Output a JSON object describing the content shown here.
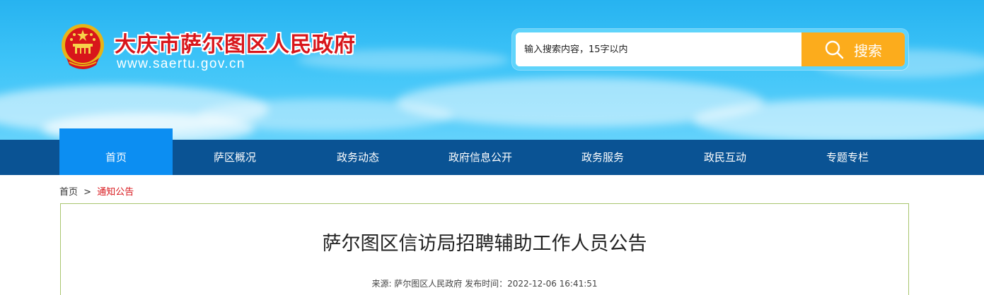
{
  "header": {
    "site_title": "大庆市萨尔图区人民政府",
    "site_url": "www.saertu.gov.cn",
    "emblem_icon": "national-emblem-icon"
  },
  "search": {
    "placeholder": "输入搜索内容，15字以内",
    "button_label": "搜索",
    "button_color": "#fcac1c"
  },
  "nav": {
    "items": [
      {
        "label": "首页",
        "active": true
      },
      {
        "label": "萨区概况"
      },
      {
        "label": "政务动态"
      },
      {
        "label": "政府信息公开"
      },
      {
        "label": "政务服务"
      },
      {
        "label": "政民互动"
      },
      {
        "label": "专题专栏"
      }
    ],
    "bar_color": "#0a5394",
    "active_color": "#0c8ef2"
  },
  "breadcrumb": {
    "home": "首页",
    "separator": ">",
    "current": "通知公告"
  },
  "article": {
    "title": "萨尔图区信访局招聘辅助工作人员公告",
    "meta": "来源: 萨尔图区人民政府 发布时间：2022-12-06 16:41:51"
  },
  "colors": {
    "title_red": "#d8161b"
  }
}
